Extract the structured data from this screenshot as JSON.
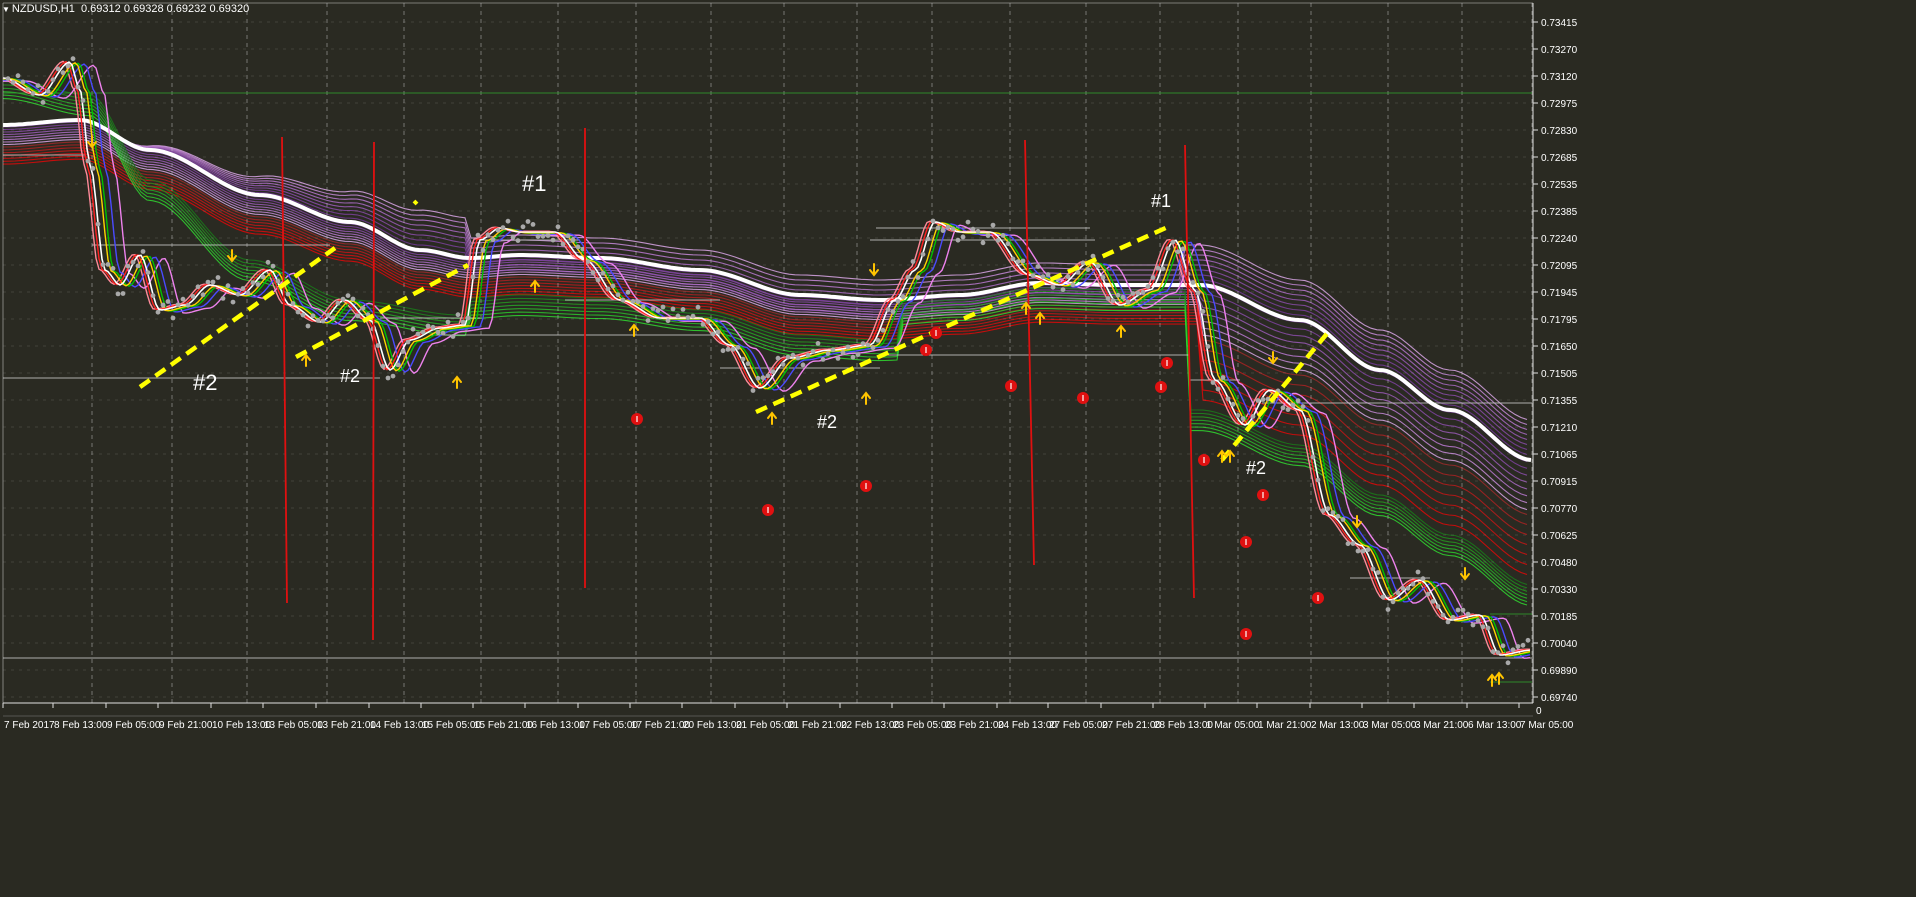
{
  "header": {
    "symbol_label": "NZDUSD,H1",
    "ohlc": "0.69312 0.69328 0.69232 0.69320",
    "menu_icon": "triangle-down-icon"
  },
  "price_axis": {
    "labels": [
      "0.73415",
      "0.73270",
      "0.73120",
      "0.72975",
      "0.72830",
      "0.72685",
      "0.72535",
      "0.72385",
      "0.72240",
      "0.72095",
      "0.71945",
      "0.71795",
      "0.71650",
      "0.71505",
      "0.71355",
      "0.71210",
      "0.71065",
      "0.70915",
      "0.70770",
      "0.70625",
      "0.70480",
      "0.70330",
      "0.70185",
      "0.70040",
      "0.69890",
      "0.69740"
    ],
    "current_marker": "0"
  },
  "time_axis": {
    "labels": [
      "7 Feb 2017",
      "8 Feb 13:00",
      "9 Feb 05:00",
      "9 Feb 21:00",
      "10 Feb 13:00",
      "13 Feb 05:00",
      "13 Feb 21:00",
      "14 Feb 13:00",
      "15 Feb 05:00",
      "15 Feb 21:00",
      "16 Feb 13:00",
      "17 Feb 05:00",
      "17 Feb 21:00",
      "20 Feb 13:00",
      "21 Feb 05:00",
      "21 Feb 21:00",
      "22 Feb 13:00",
      "23 Feb 05:00",
      "23 Feb 21:00",
      "24 Feb 13:00",
      "27 Feb 05:00",
      "27 Feb 21:00",
      "28 Feb 13:00",
      "1 Mar 05:00",
      "1 Mar 21:00",
      "2 Mar 13:00",
      "3 Mar 05:00",
      "3 Mar 21:00",
      "6 Mar 13:00",
      "7 Mar 05:00"
    ]
  },
  "annotations": [
    {
      "text": "#2",
      "size": 22
    },
    {
      "text": "#2",
      "size": 18
    },
    {
      "text": "#1",
      "size": 22
    },
    {
      "text": "#2",
      "size": 18
    },
    {
      "text": "#1",
      "size": 18
    },
    {
      "text": "#2",
      "size": 18
    }
  ],
  "colors": {
    "background": "#2a2a22",
    "grid": "#d8d8d8",
    "axis_text": "#ffffff",
    "trend_line": "#ffff00",
    "vertical_marker": "#e01010",
    "arrow": "#ffc400",
    "signal_dot": "#e01010",
    "price_dots": "#a8a8a8",
    "slow_ma": "#ffffff"
  }
}
